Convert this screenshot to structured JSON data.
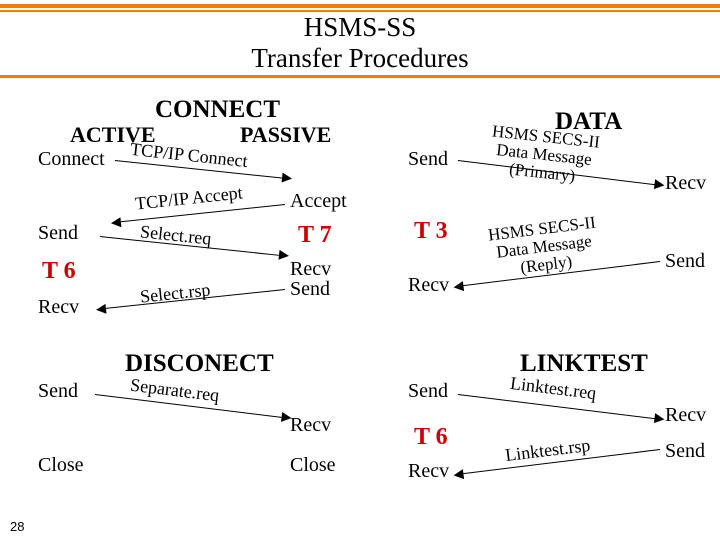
{
  "title_line1": "HSMS-SS",
  "title_line2": "Transfer Procedures",
  "page_number": "28",
  "connect": {
    "header": "CONNECT",
    "active": "ACTIVE",
    "passive": "PASSIVE",
    "left_connect": "Connect",
    "left_send": "Send",
    "left_t6": "T 6",
    "left_recv": "Recv",
    "right_accept": "Accept",
    "right_t7": "T 7",
    "right_recvsend_r": "Recv",
    "right_recvsend_s": "Send",
    "msg_tcp_connect": "TCP/IP Connect",
    "msg_tcp_accept": "TCP/IP Accept",
    "msg_select_req": "Select.req",
    "msg_select_rsp": "Select.rsp"
  },
  "data": {
    "header": "DATA",
    "left_send": "Send",
    "left_t3": "T 3",
    "left_recv": "Recv",
    "right_recv": "Recv",
    "right_send": "Send",
    "msg_primary_l1": "HSMS SECS-II",
    "msg_primary_l2": "Data Message",
    "msg_primary_l3": "(Primary)",
    "msg_reply_l1": "HSMS SECS-II",
    "msg_reply_l2": "Data Message",
    "msg_reply_l3": "(Reply)"
  },
  "disconnect": {
    "header": "DISCONECT",
    "left_send": "Send",
    "left_close": "Close",
    "right_recv": "Recv",
    "right_close": "Close",
    "msg_separate": "Separate.req"
  },
  "linktest": {
    "header": "LINKTEST",
    "left_send": "Send",
    "left_t6": "T 6",
    "left_recv": "Recv",
    "right_recv": "Recv",
    "right_send": "Send",
    "msg_req": "Linktest.req",
    "msg_rsp": "Linktest.rsp"
  }
}
